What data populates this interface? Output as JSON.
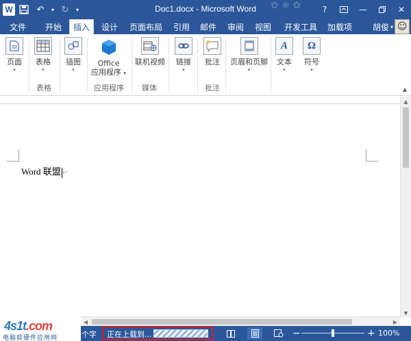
{
  "titlebar": {
    "app_icon": "W",
    "title": "Doc1.docx - Microsoft Word",
    "help": "?",
    "qat_icons": [
      "save-icon",
      "undo-icon",
      "redo-icon",
      "customize-icon"
    ]
  },
  "tabs": {
    "file": "文件",
    "items": [
      "开始",
      "插入",
      "设计",
      "页面布局",
      "引用",
      "邮件",
      "审阅",
      "视图",
      "开发工具",
      "加载项"
    ],
    "active": "插入",
    "user": "胡俊"
  },
  "ribbon": {
    "buttons": {
      "page": "页面",
      "table": "表格",
      "illustrations": "插图",
      "office_apps_line1": "Office",
      "office_apps_line2": "应用程序",
      "online_video": "联机视频",
      "link": "链接",
      "comment": "批注",
      "header_footer": "页眉和页脚",
      "text": "文本",
      "symbols": "符号"
    },
    "groups": {
      "table": "表格",
      "apps": "应用程序",
      "media": "媒体",
      "comments": "批注"
    }
  },
  "document": {
    "text": "Word 联盟"
  },
  "statusbar": {
    "word_count": "个字",
    "upload_status": "正在上载到...",
    "zoom": "100%",
    "zoom_level": 1.0
  },
  "watermark": {
    "logo_main": "4s1t",
    "logo_dot": ".com",
    "subtitle": "电脑软硬件应用网"
  },
  "colors": {
    "accent": "#2b579a",
    "highlight_box": "#e01b1b"
  }
}
